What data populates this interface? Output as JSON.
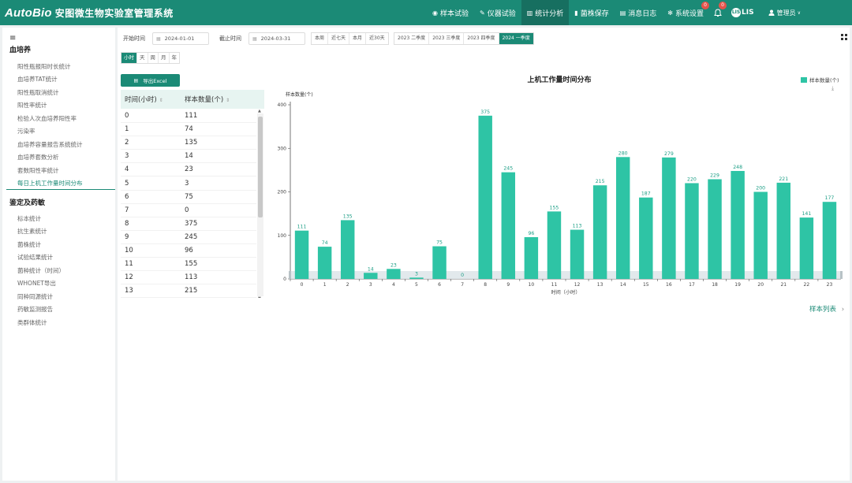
{
  "header": {
    "logo": "AutoBio",
    "system_name": "安图微生物实验室管理系统",
    "nav": [
      {
        "icon": "◉",
        "label": "样本试验"
      },
      {
        "icon": "✎",
        "label": "仪器试验"
      },
      {
        "icon": "▥",
        "label": "统计分析",
        "active": true
      },
      {
        "icon": "▮",
        "label": "菌株保存"
      },
      {
        "icon": "▤",
        "label": "消息日志"
      },
      {
        "icon": "✻",
        "label": "系统设置"
      }
    ],
    "system_badge": "0",
    "bell_badge": "0",
    "lis_label": "LIS",
    "lis_dot": "LIS",
    "user_label": "管理员",
    "user_caret": "∨"
  },
  "sidebar": {
    "menu_icon": "≡",
    "groups": [
      {
        "title": "血培养",
        "items": [
          "阳性瓶报阳时长统计",
          "血培养TAT统计",
          "阳性瓶取消统计",
          "阳性率统计",
          "检验人次血培养阳性率",
          "污染率",
          "血培养容量报告系统统计",
          "血培养套数分析",
          "套数阳性率统计",
          "每日上机工作量时间分布"
        ],
        "active_index": 9
      },
      {
        "title": "鉴定及药敏",
        "items": [
          "标本统计",
          "抗生素统计",
          "菌株统计",
          "试验结果统计",
          "菌种统计（时间）",
          "WHONET导出",
          "同种同源统计",
          "药敏监测报告",
          "类群体统计"
        ]
      }
    ]
  },
  "filters": {
    "start_label": "开始时间",
    "start_value": "2024-01-01",
    "end_label": "截止时间",
    "end_value": "2024-03-31",
    "quick_a": [
      "本周",
      "近七天",
      "本月",
      "近30天"
    ],
    "quick_b": [
      "2023 二季度",
      "2023 三季度",
      "2023 四季度",
      "2024 一季度"
    ],
    "quick_b_active": 3,
    "granularity": [
      "小时",
      "天",
      "周",
      "月",
      "年"
    ],
    "granularity_active": 0
  },
  "export_label": "导出Excel",
  "table": {
    "col_time": "时间(小时)",
    "col_count": "样本数量(个)",
    "rows": [
      [
        "0",
        "111"
      ],
      [
        "1",
        "74"
      ],
      [
        "2",
        "135"
      ],
      [
        "3",
        "14"
      ],
      [
        "4",
        "23"
      ],
      [
        "5",
        "3"
      ],
      [
        "6",
        "75"
      ],
      [
        "7",
        "0"
      ],
      [
        "8",
        "375"
      ],
      [
        "9",
        "245"
      ],
      [
        "10",
        "96"
      ],
      [
        "11",
        "155"
      ],
      [
        "12",
        "113"
      ],
      [
        "13",
        "215"
      ]
    ]
  },
  "chart_data": {
    "type": "bar",
    "title": "上机工作量时间分布",
    "xlabel": "时间（小时）",
    "ylabel": "样本数量(个)",
    "legend": "样本数量(个)",
    "legend_position": "top-right",
    "color": "#2ec4a5",
    "categories": [
      "0",
      "1",
      "2",
      "3",
      "4",
      "5",
      "6",
      "7",
      "8",
      "9",
      "10",
      "11",
      "12",
      "13",
      "14",
      "15",
      "16",
      "17",
      "18",
      "19",
      "20",
      "21",
      "22",
      "23"
    ],
    "values": [
      111,
      74,
      135,
      14,
      23,
      3,
      75,
      0,
      375,
      245,
      96,
      155,
      113,
      215,
      280,
      187,
      279,
      220,
      229,
      248,
      200,
      221,
      141,
      177
    ],
    "yticks": [
      "0",
      "100",
      "200",
      "300",
      "400"
    ],
    "ylim": [
      0,
      400
    ],
    "grid": false,
    "datazoom": true
  },
  "sample_list_label": "样本列表",
  "sample_list_arrow": "›"
}
